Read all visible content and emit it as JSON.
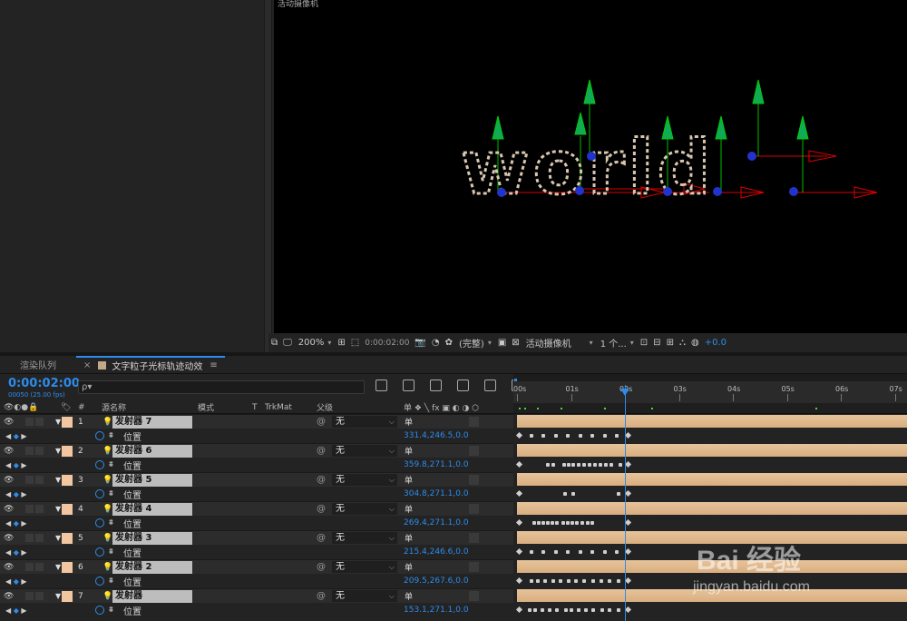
{
  "viewer": {
    "label": "活动摄像机",
    "word": "world"
  },
  "viewer_toolbar": {
    "zoom": "200%",
    "timecode": "0:00:02:00",
    "resolution": "(完整)",
    "camera": "活动摄像机",
    "views": "1 个...",
    "exposure": "+0.0"
  },
  "tabs": {
    "render_queue": "渲染队列",
    "comp_close": "×",
    "comp_name": "文字粒子光标轨迹动效",
    "comp_menu": "≡"
  },
  "timeline": {
    "timecode": "0:00:02:00",
    "frame_info": "00050 (25.00 fps)",
    "search_placeholder": "ρ▾"
  },
  "columns": {
    "num": "#",
    "source_name": "源名称",
    "mode": "模式",
    "t": "T",
    "trkmat": "TrkMat",
    "parent": "父级",
    "switches": "单 ❖ ╲ fx ▣ ◐ ◑ ⬡"
  },
  "ruler": {
    "ticks": [
      "00s",
      "01s",
      "02s",
      "03s",
      "04s",
      "05s",
      "06s",
      "07s"
    ]
  },
  "layers": [
    {
      "num": "1",
      "name": "发射器 7",
      "parent": "无",
      "switch": "单",
      "prop": "位置",
      "value": "331.4,246.5,0.0",
      "keys": [
        0,
        14,
        27,
        41,
        54,
        68,
        81,
        95,
        108,
        120
      ]
    },
    {
      "num": "2",
      "name": "发射器 6",
      "parent": "无",
      "switch": "单",
      "prop": "位置",
      "value": "359.8,271.1,0.0",
      "keys": [
        0,
        32,
        38,
        50,
        55,
        60,
        66,
        72,
        78,
        84,
        90,
        96,
        102,
        112,
        120
      ]
    },
    {
      "num": "3",
      "name": "发射器 5",
      "parent": "无",
      "switch": "单",
      "prop": "位置",
      "value": "304.8,271.1,0.0",
      "keys": [
        0,
        51,
        60,
        110,
        120
      ]
    },
    {
      "num": "4",
      "name": "发射器 4",
      "parent": "无",
      "switch": "单",
      "prop": "位置",
      "value": "269.4,271.1,0.0",
      "keys": [
        0,
        17,
        22,
        27,
        32,
        37,
        42,
        49,
        54,
        59,
        64,
        70,
        76,
        81,
        120
      ]
    },
    {
      "num": "5",
      "name": "发射器 3",
      "parent": "无",
      "switch": "单",
      "prop": "位置",
      "value": "215.4,246.6,0.0",
      "keys": [
        0,
        14,
        27,
        41,
        54,
        68,
        81,
        95,
        108,
        120
      ]
    },
    {
      "num": "6",
      "name": "发射器 2",
      "parent": "无",
      "switch": "单",
      "prop": "位置",
      "value": "209.5,267.6,0.0",
      "keys": [
        0,
        14,
        21,
        29,
        38,
        46,
        55,
        63,
        72,
        82,
        91,
        100,
        110,
        120
      ]
    },
    {
      "num": "7",
      "name": "发射器",
      "parent": "无",
      "switch": "单",
      "prop": "位置",
      "value": "153.1,271.1,0.0",
      "keys": [
        0,
        12,
        18,
        26,
        34,
        42,
        52,
        58,
        66,
        74,
        82,
        92,
        100,
        110,
        120
      ]
    }
  ],
  "watermark": {
    "logo": "Bai 经验",
    "url": "jingyan.baidu.com"
  },
  "colors": {
    "accent": "#2d8ceb",
    "layer_label": "#f2c6a0",
    "layer_bar": "#e0b88b"
  }
}
